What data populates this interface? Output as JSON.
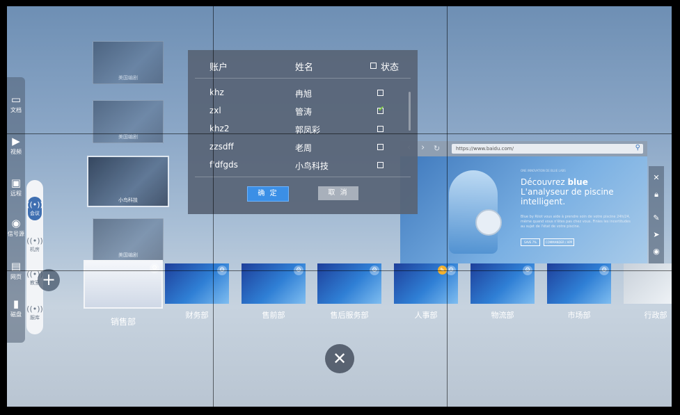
{
  "dock": {
    "items": [
      {
        "label": "文档",
        "icon": "folder-icon"
      },
      {
        "label": "视频",
        "icon": "play-icon"
      },
      {
        "label": "远程",
        "icon": "monitor-icon"
      },
      {
        "label": "信号源",
        "icon": "signal-icon"
      },
      {
        "label": "网页",
        "icon": "webpage-icon"
      },
      {
        "label": "磁盘",
        "icon": "disk-icon"
      }
    ],
    "sub_items": [
      {
        "label": "会议",
        "icon": "broadcast-icon"
      },
      {
        "label": "机房",
        "icon": "broadcast-icon"
      },
      {
        "label": "教室",
        "icon": "broadcast-icon"
      },
      {
        "label": "服库",
        "icon": "broadcast-icon"
      }
    ],
    "plus": "+"
  },
  "vertical_carousel": [
    {
      "caption": "美国编剧"
    },
    {
      "caption": "美国编剧"
    },
    {
      "caption": "小鸟科技"
    },
    {
      "caption": "美国编剧"
    }
  ],
  "dialog": {
    "headers": {
      "account": "账户",
      "name": "姓名",
      "status": "状态"
    },
    "rows": [
      {
        "account": "khz",
        "name": "冉旭",
        "checked": false
      },
      {
        "account": "zxl",
        "name": "管涛",
        "checked": true
      },
      {
        "account": "khz2",
        "name": "郭凤彩",
        "checked": false
      },
      {
        "account": "zzsdff",
        "name": "老周",
        "checked": false
      },
      {
        "account": "f'dfgds",
        "name": "小鸟科技",
        "checked": false
      }
    ],
    "ok": "确 定",
    "cancel": "取 消"
  },
  "browser": {
    "url": "https://www.baidu.com/",
    "tagline": "ONE INNOVATION DE BLUE LABS",
    "headline_1": "Découvrez",
    "headline_bold": "blue",
    "headline_2": "L'analyseur de piscine intelligent.",
    "body": "Blue by Riiot vous aide à prendre soin de votre piscine 24h/24, même quand vous n'êtes pas chez vous. Finies les incertitudes au sujet de l'état de votre piscine.",
    "btn1": "SAVE 7%",
    "btn2": "COMMANDER / APP"
  },
  "departments": [
    {
      "label": "销售部",
      "selected": true
    },
    {
      "label": "财务部"
    },
    {
      "label": "售前部"
    },
    {
      "label": "售后服务部"
    },
    {
      "label": "人事部"
    },
    {
      "label": "物流部"
    },
    {
      "label": "市场部"
    },
    {
      "label": "行政部"
    }
  ],
  "close_label": "✕"
}
